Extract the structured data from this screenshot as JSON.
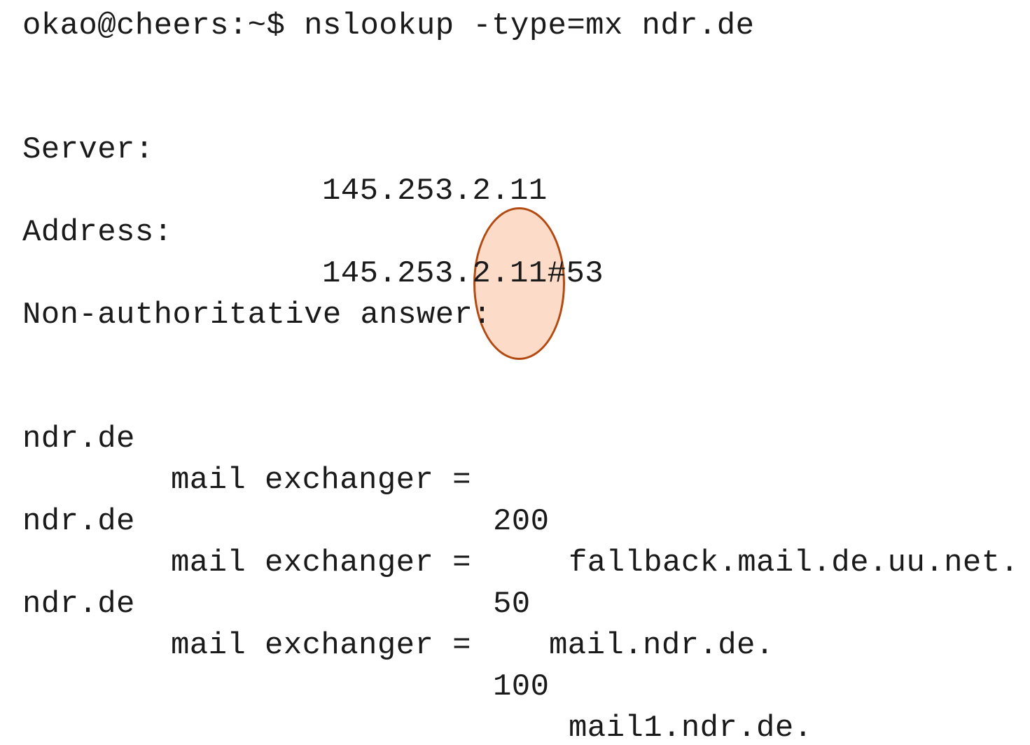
{
  "terminal": {
    "prompt_line": "okao@cheers:~$ nslookup -type=mx ndr.de",
    "server_label": "Server:",
    "server_value": "145.253.2.11",
    "address_label": "Address:",
    "address_value": "145.253.2.11#53",
    "answer_header": "Non-authoritative answer:",
    "mx_records": [
      {
        "host": "ndr.de",
        "type": "mail exchanger =",
        "preference": "200",
        "exchanger": "fallback.mail.de.uu.net."
      },
      {
        "host": "ndr.de",
        "type": "mail exchanger =",
        "preference": "50",
        "exchanger": "mail.ndr.de."
      },
      {
        "host": "ndr.de",
        "type": "mail exchanger =",
        "preference": "100",
        "exchanger": "mail1.ndr.de."
      }
    ]
  },
  "highlight": {
    "fill_color": "#fcdcc8",
    "stroke_color": "#b34a12"
  }
}
